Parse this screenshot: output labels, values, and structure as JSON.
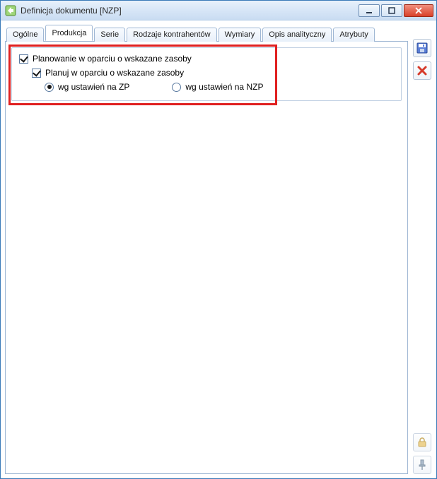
{
  "window": {
    "title": "Definicja dokumentu [NZP]"
  },
  "tabs": [
    {
      "label": "Ogólne"
    },
    {
      "label": "Produkcja"
    },
    {
      "label": "Serie"
    },
    {
      "label": "Rodzaje kontrahentów"
    },
    {
      "label": "Wymiary"
    },
    {
      "label": "Opis analityczny"
    },
    {
      "label": "Atrybuty"
    }
  ],
  "active_tab_index": 1,
  "produkcja": {
    "master_checkbox": {
      "label": "Planowanie w oparciu o wskazane zasoby",
      "checked": true
    },
    "sub_checkbox": {
      "label": "Planuj w oparciu o wskazane zasoby",
      "checked": true
    },
    "radio": {
      "options": [
        {
          "label": "wg ustawień na ZP",
          "selected": true
        },
        {
          "label": "wg ustawień na NZP",
          "selected": false
        }
      ]
    }
  },
  "icons": {
    "app": "app-icon",
    "minimize": "minimize-icon",
    "maximize": "maximize-icon",
    "close": "close-icon",
    "save": "save-icon",
    "delete": "delete-icon",
    "lock": "lock-icon",
    "pin": "pin-icon"
  }
}
